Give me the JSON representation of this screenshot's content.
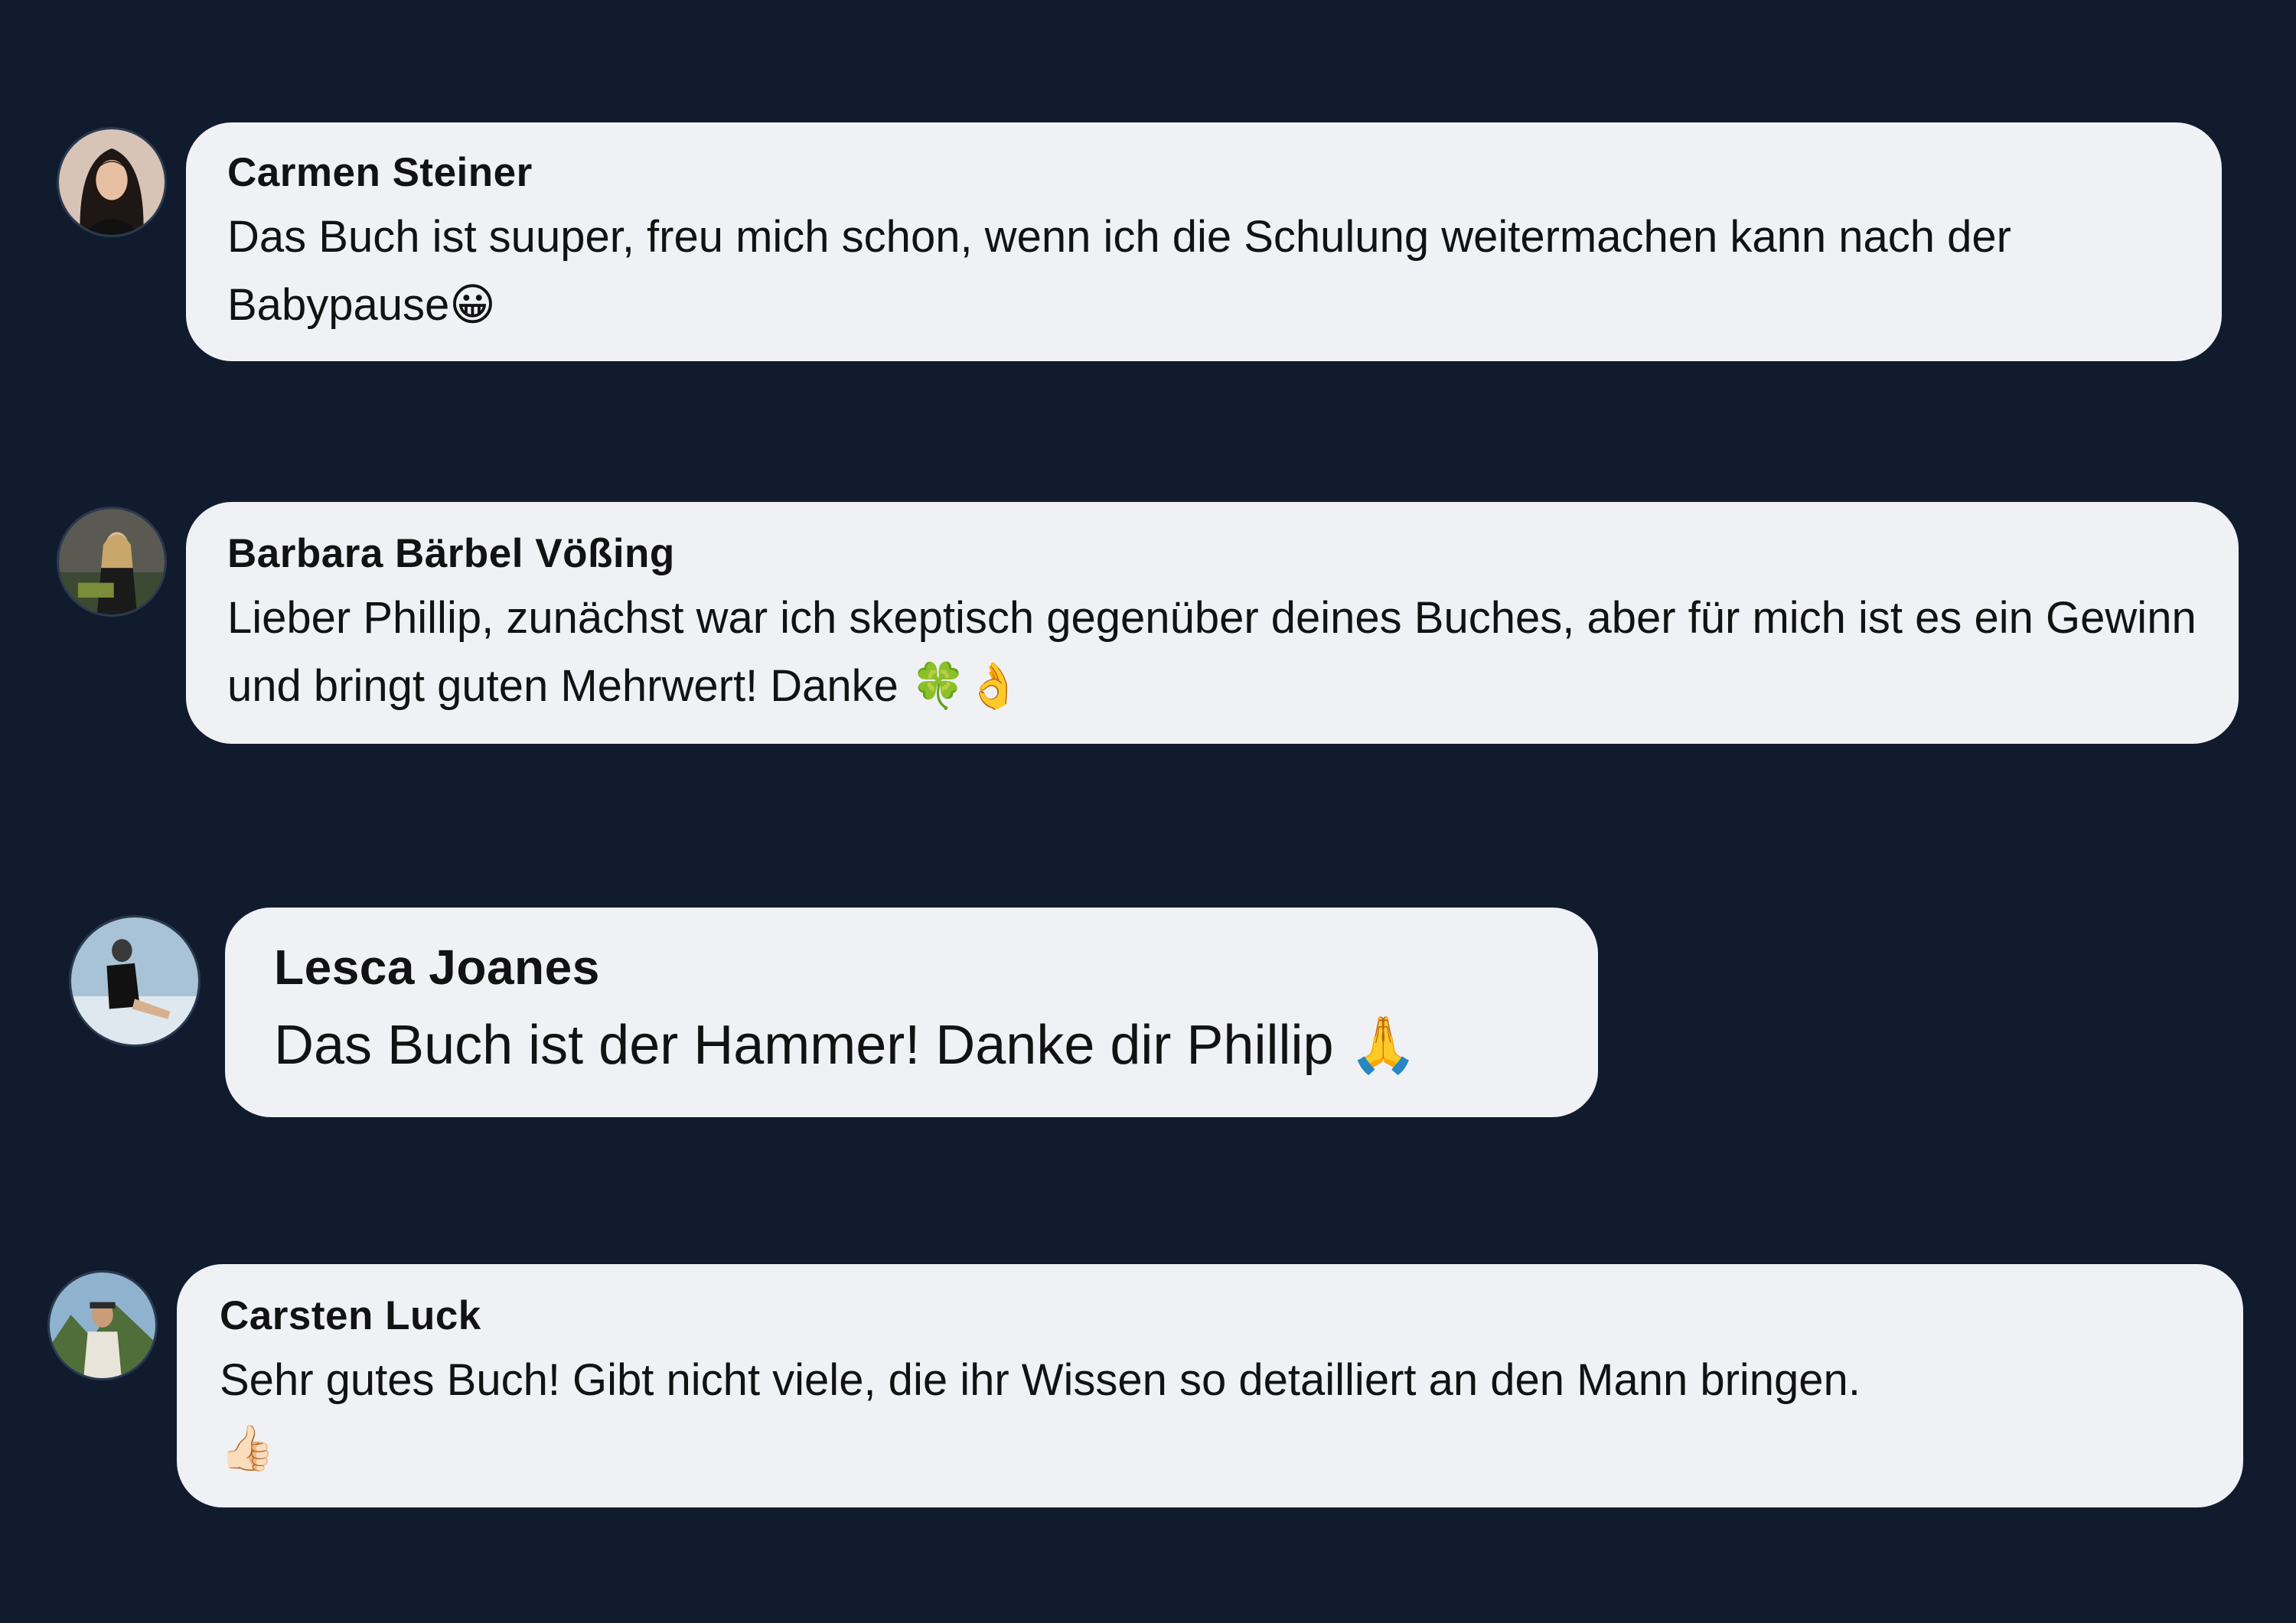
{
  "colors": {
    "background": "#101c2e",
    "bubble": "#f0f1f4",
    "text": "#121212"
  },
  "comments": [
    {
      "author": "Carmen Steiner",
      "text": "Das Buch ist suuper, freu mich schon, wenn ich die Schulung weitermachen kann nach der Babypause",
      "emoji": "😀",
      "avatar_icon": "avatar-woman-dark-hair"
    },
    {
      "author": "Barbara Bärbel Vößing",
      "text": "Lieber Phillip, zunächst war ich skeptisch gegenüber deines Buches, aber für mich ist es ein Gewinn und bringt guten Mehrwert! Danke",
      "emoji": "🍀👌",
      "avatar_icon": "avatar-woman-blonde"
    },
    {
      "author": "Lesca Joanes",
      "text": "Das Buch ist der Hammer! Danke dir Phillip",
      "emoji": "🙏",
      "avatar_icon": "avatar-person-sitting"
    },
    {
      "author": "Carsten Luck",
      "text": "Sehr gutes Buch! Gibt nicht viele, die ihr Wissen so detailliert an den Mann bringen.",
      "emoji": "👍🏻",
      "avatar_icon": "avatar-man-outdoors"
    }
  ]
}
